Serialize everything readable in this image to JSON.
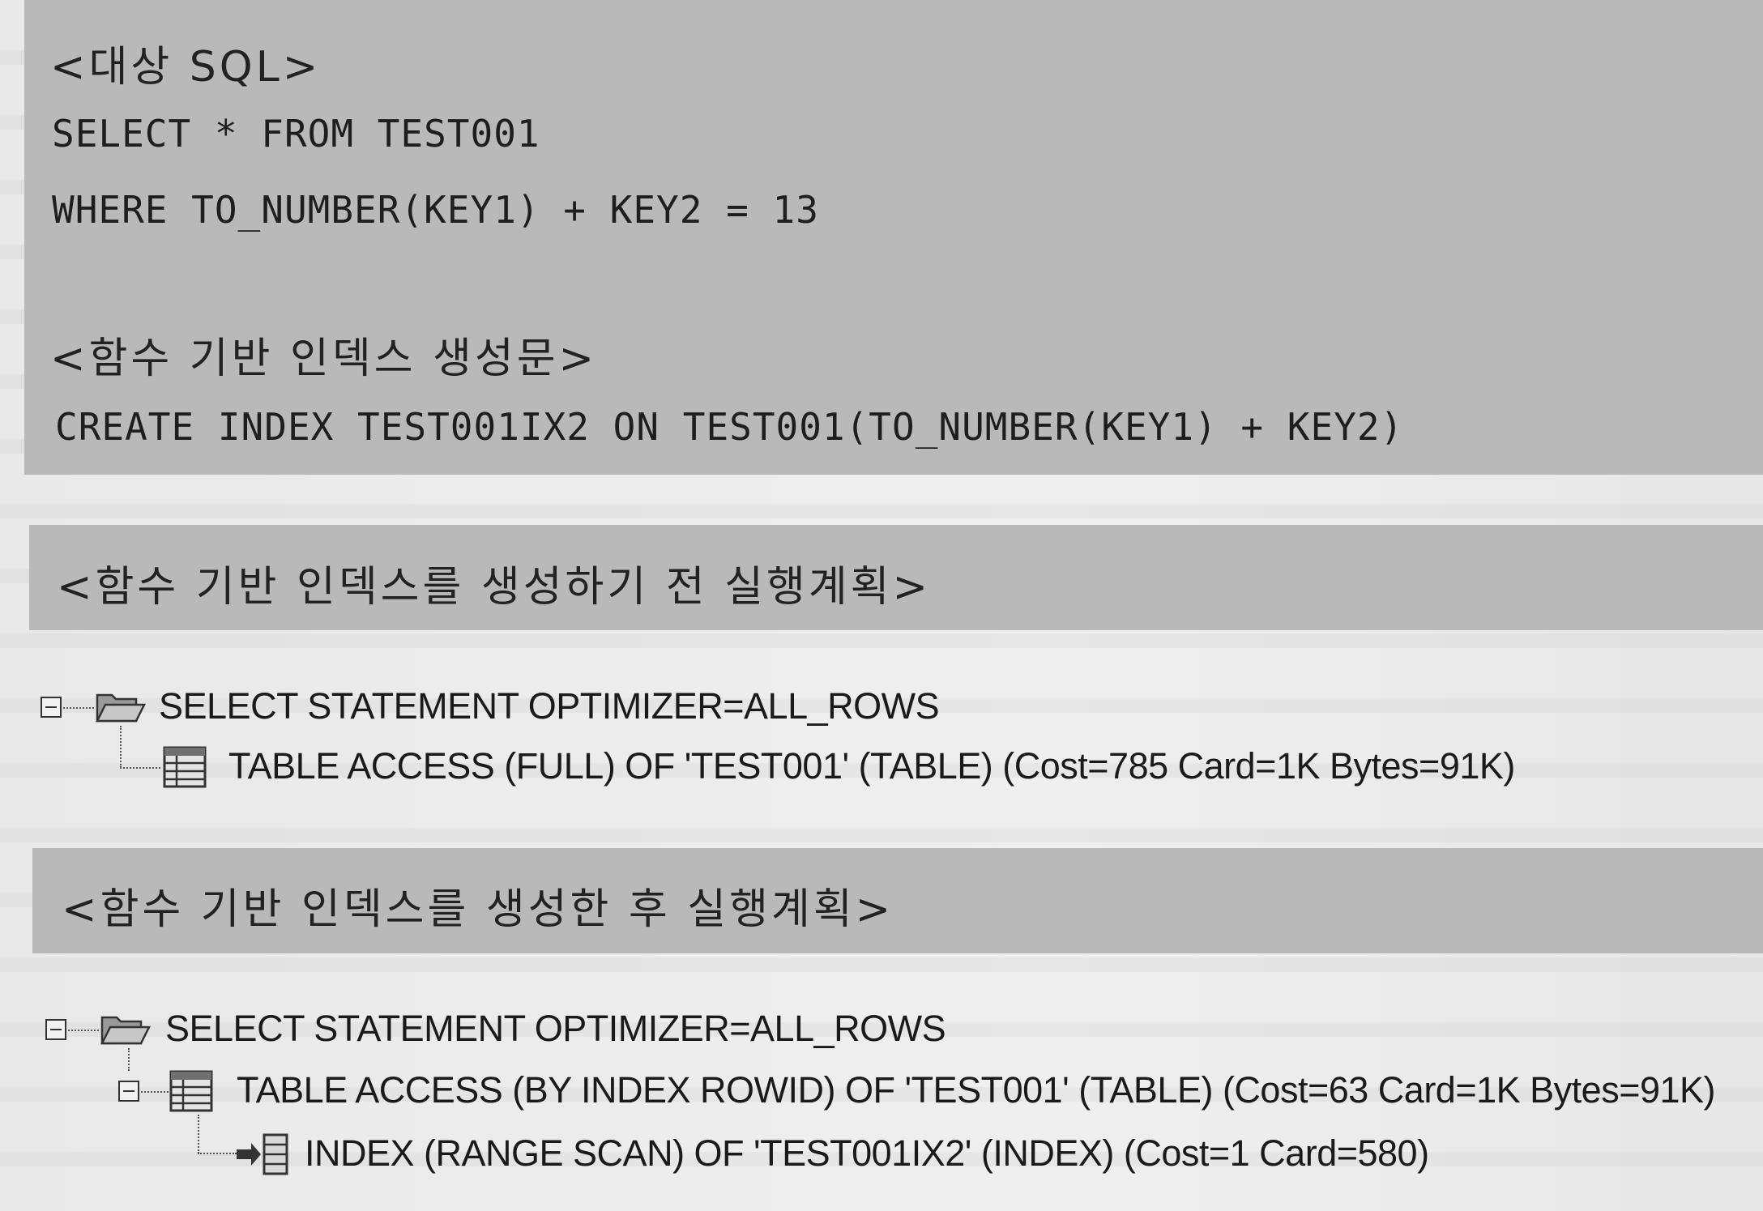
{
  "sql_section": {
    "target_heading": "<대상 SQL>",
    "select_line": "SELECT * FROM TEST001",
    "where_line": "WHERE TO_NUMBER(KEY1) + KEY2 = 13",
    "create_heading": "<함수 기반 인덱스 생성문>",
    "create_line": "CREATE INDEX TEST001IX2 ON TEST001(TO_NUMBER(KEY1) + KEY2)"
  },
  "before_section": {
    "heading": "<함수 기반 인덱스를 생성하기 전 실행계획>",
    "plan": [
      {
        "text": "SELECT STATEMENT OPTIMIZER=ALL_ROWS",
        "icon": "folder-icon"
      },
      {
        "text": "TABLE ACCESS (FULL) OF 'TEST001' (TABLE) (Cost=785 Card=1K Bytes=91K)",
        "icon": "table-icon"
      }
    ]
  },
  "after_section": {
    "heading": "<함수 기반 인덱스를 생성한 후 실행계획>",
    "plan": [
      {
        "text": "SELECT STATEMENT OPTIMIZER=ALL_ROWS",
        "icon": "folder-icon"
      },
      {
        "text": "TABLE ACCESS (BY INDEX ROWID) OF 'TEST001' (TABLE) (Cost=63 Card=1K Bytes=91K)",
        "icon": "table-icon"
      },
      {
        "text": "INDEX (RANGE SCAN) OF 'TEST001IX2' (INDEX) (Cost=1 Card=580)",
        "icon": "index-icon"
      }
    ]
  },
  "colors": {
    "block_gray": "#b9b9b9",
    "page_background": "#ececec",
    "text": "#1c1c1c"
  }
}
